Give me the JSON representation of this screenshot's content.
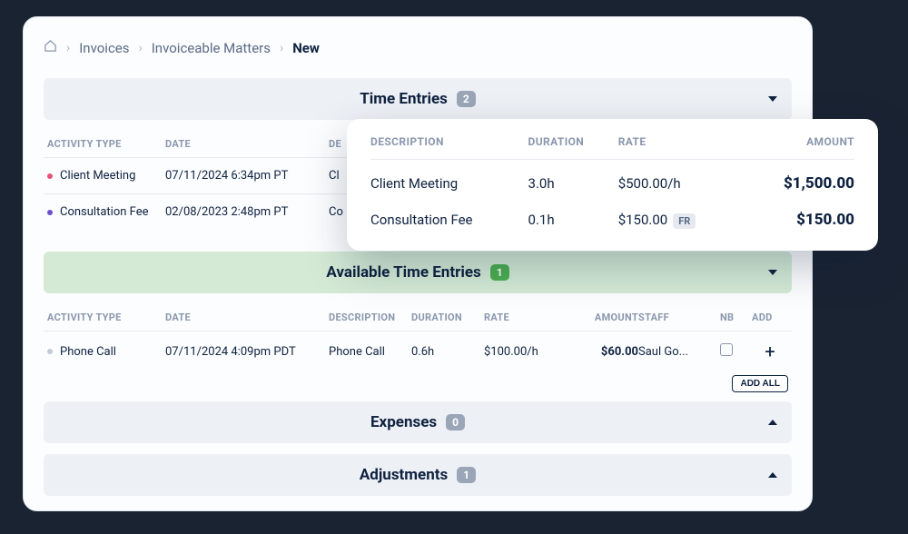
{
  "breadcrumb": {
    "invoices": "Invoices",
    "invoiceable": "Invoiceable Matters",
    "new": "New"
  },
  "sections": {
    "time_entries": {
      "title": "Time Entries",
      "count": "2"
    },
    "available": {
      "title": "Available Time Entries",
      "count": "1"
    },
    "expenses": {
      "title": "Expenses",
      "count": "0"
    },
    "adjustments": {
      "title": "Adjustments",
      "count": "1"
    }
  },
  "headers": {
    "activity_type": "ACTIVITY TYPE",
    "date": "DATE",
    "description": "DESCRIPTION",
    "duration": "DURATION",
    "rate": "RATE",
    "amount": "AMOUNT",
    "staff": "STAFF",
    "nb": "NB",
    "add": "ADD"
  },
  "time_rows": [
    {
      "activity": "Client Meeting",
      "date": "07/11/2024 6:34pm PT",
      "desc_short": "Cl"
    },
    {
      "activity": "Consultation Fee",
      "date": "02/08/2023 2:48pm PT",
      "desc_short": "Co"
    }
  ],
  "available_rows": [
    {
      "activity": "Phone Call",
      "date": "07/11/2024 4:09pm PDT",
      "desc": "Phone Call",
      "duration": "0.6h",
      "rate": "$100.00/h",
      "amount": "$60.00",
      "staff": "Saul Go..."
    }
  ],
  "buttons": {
    "add_all": "ADD ALL"
  },
  "popup": {
    "headers": {
      "description": "DESCRIPTION",
      "duration": "DURATION",
      "rate": "RATE",
      "amount": "AMOUNT"
    },
    "rows": [
      {
        "desc": "Client Meeting",
        "duration": "3.0h",
        "rate": "$500.00/h",
        "fr": "",
        "amount": "$1,500.00"
      },
      {
        "desc": "Consultation Fee",
        "duration": "0.1h",
        "rate": "$150.00",
        "fr": "FR",
        "amount": "$150.00"
      }
    ]
  }
}
